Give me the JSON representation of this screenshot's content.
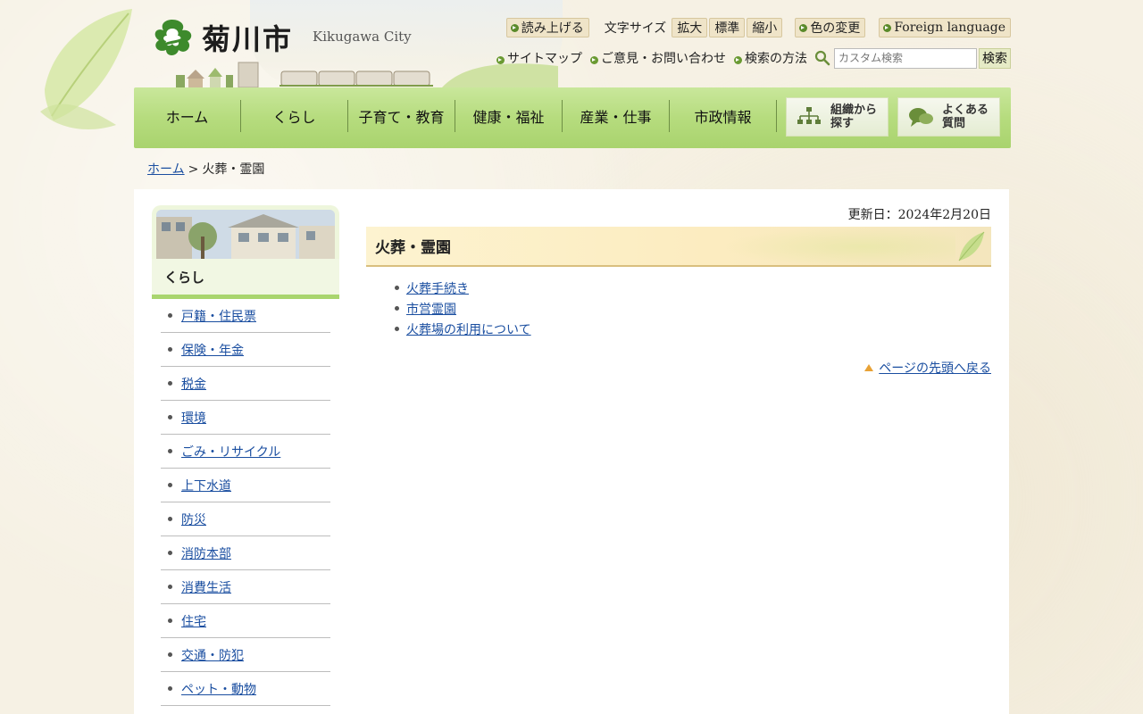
{
  "header": {
    "logo_text": "菊川市",
    "logo_en": "Kikugawa City",
    "read_aloud": "読み上げる",
    "font_size_label": "文字サイズ",
    "font_size_buttons": [
      "拡大",
      "標準",
      "縮小"
    ],
    "color_change": "色の変更",
    "foreign_language": "Foreign language",
    "sitemap": "サイトマップ",
    "feedback": "ご意見・お問い合わせ",
    "search_method": "検索の方法",
    "search_placeholder": "カスタム検索",
    "search_button": "検索"
  },
  "nav": {
    "items": [
      "ホーム",
      "くらし",
      "子育て・教育",
      "健康・福祉",
      "産業・仕事",
      "市政情報"
    ],
    "org_search": [
      "組織から",
      "探す"
    ],
    "faq": [
      "よくある",
      "質問"
    ]
  },
  "breadcrumb": {
    "home": "ホーム",
    "separator": ">",
    "current": "火葬・霊園"
  },
  "side": {
    "title": "くらし",
    "items": [
      "戸籍・住民票",
      "保険・年金",
      "税金",
      "環境",
      "ごみ・リサイクル",
      "上下水道",
      "防災",
      "消防本部",
      "消費生活",
      "住宅",
      "交通・防犯",
      "ペット・動物"
    ]
  },
  "main": {
    "updated": "更新日：2024年2月20日",
    "title": "火葬・霊園",
    "links": [
      "火葬手続き",
      "市営霊園",
      "火葬場の利用について"
    ],
    "page_top": "ページの先頭へ戻る"
  },
  "colors": {
    "nav_green": "#b6dc7e",
    "link_blue": "#1a4ea0",
    "title_bg": "#fcecc0",
    "accent_orange": "#e8a236"
  }
}
